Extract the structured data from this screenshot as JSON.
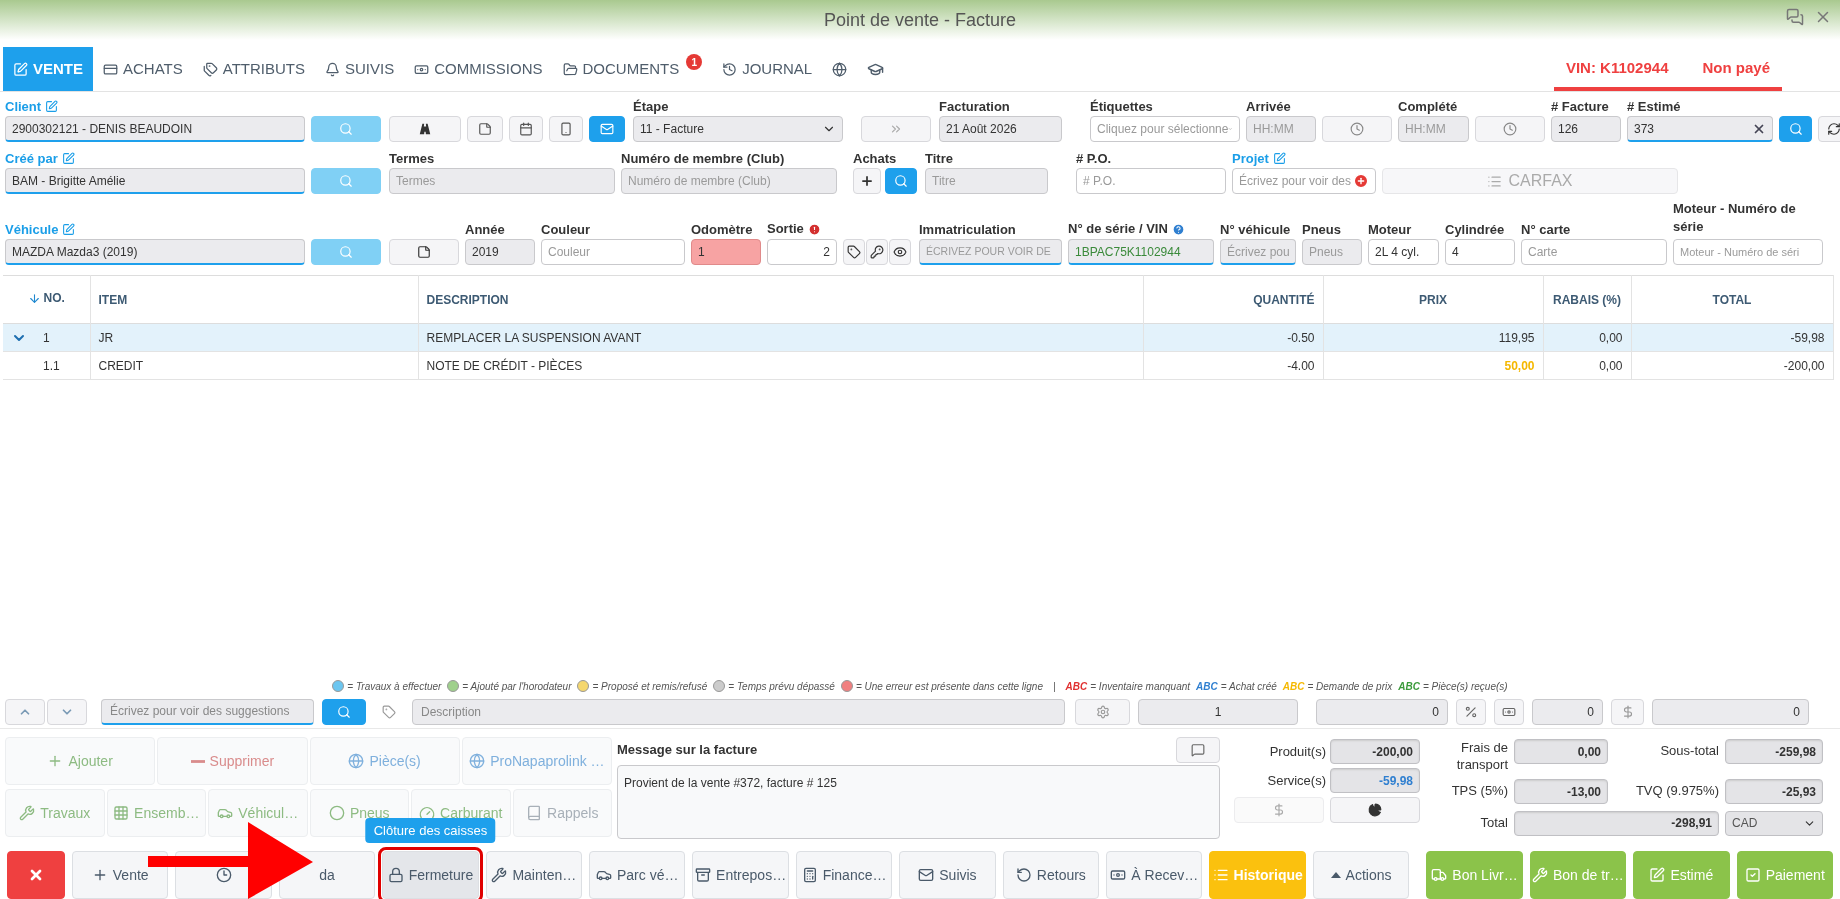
{
  "window": {
    "title": "Point de vente - Facture"
  },
  "tabs": [
    {
      "label": "VENTE",
      "selected": true
    },
    {
      "label": "ACHATS",
      "selected": false
    },
    {
      "label": "ATTRIBUTS",
      "selected": false
    },
    {
      "label": "SUIVIS",
      "selected": false
    },
    {
      "label": "COMMISSIONS",
      "selected": false
    },
    {
      "label": "DOCUMENTS",
      "selected": false,
      "badge": "1"
    },
    {
      "label": "JOURNAL",
      "selected": false
    }
  ],
  "status": {
    "vin": "VIN: K1102944",
    "payment": "Non payé"
  },
  "form": {
    "client": {
      "label": "Client",
      "editable": true,
      "value": "2900302121 - DENIS BEAUDOIN"
    },
    "email_button": {
      "selected": true
    },
    "stage": {
      "label": "Étape",
      "value": "11 - Facture"
    },
    "billing": {
      "label": "Facturation",
      "value": "21 Août 2026"
    },
    "tags": {
      "label": "Étiquettes",
      "placeholder": "Cliquez pour sélectionne"
    },
    "arrival": {
      "label": "Arrivée",
      "placeholder": "HH:MM"
    },
    "completed": {
      "label": "Complété",
      "placeholder": "HH:MM"
    },
    "invoice_no": {
      "label": "# Facture",
      "value": "126"
    },
    "estimate_no": {
      "label": "# Estimé",
      "value": "373"
    },
    "created_by": {
      "label": "Créé par",
      "editable": true,
      "value": "BAM - Brigitte Amélie"
    },
    "terms": {
      "label": "Termes",
      "placeholder": "Termes"
    },
    "member_no": {
      "label": "Numéro de membre (Club)",
      "placeholder": "Numéro de membre (Club)"
    },
    "purchases": {
      "label": "Achats"
    },
    "title": {
      "label": "Titre",
      "placeholder": "Titre"
    },
    "po": {
      "label": "# P.O.",
      "placeholder": "# P.O."
    },
    "project": {
      "label": "Projet",
      "editable": true,
      "placeholder": "Écrivez pour voir des"
    },
    "carfax": {
      "label": "CARFAX"
    },
    "vehicle": {
      "label": "Véhicule",
      "editable": true,
      "value": "MAZDA Mazda3 (2019)"
    },
    "year": {
      "label": "Année",
      "value": "2019"
    },
    "color": {
      "label": "Couleur",
      "placeholder": "Couleur"
    },
    "odometer": {
      "label": "Odomètre",
      "value": "1",
      "error": true
    },
    "exit": {
      "label": "Sortie",
      "value": "2"
    },
    "plate": {
      "label": "Immatriculation",
      "placeholder": "ÉCRIVEZ POUR VOIR DE"
    },
    "vin": {
      "label": "N° de série / VIN",
      "value": "1BPAC75K1102944"
    },
    "vehicle_no": {
      "label": "N° véhicule",
      "placeholder": "Écrivez pou"
    },
    "tires": {
      "label": "Pneus",
      "placeholder": "Pneus"
    },
    "engine": {
      "label": "Moteur",
      "value": "2L  4 cyl."
    },
    "cylinders": {
      "label": "Cylindrée",
      "value": "4"
    },
    "card_no": {
      "label": "N° carte",
      "placeholder": "Carte"
    },
    "engine_serial": {
      "label": "Moteur - Numéro de série",
      "placeholder": "Moteur - Numéro de séri"
    }
  },
  "table": {
    "columns": [
      "NO.",
      "ITEM",
      "DESCRIPTION",
      "QUANTITÉ",
      "PRIX",
      "RABAIS (%)",
      "TOTAL"
    ],
    "rows": [
      {
        "no": "1",
        "item": "JR",
        "description": "REMPLACER LA SUSPENSION AVANT",
        "quantity": "-0.50",
        "price": "119,95",
        "discount": "0,00",
        "total": "-59,98",
        "selected": true,
        "expanded": true,
        "price_highlight": false
      },
      {
        "no": "1.1",
        "item": "CREDIT",
        "description": "NOTE DE CRÉDIT - PIÈCES",
        "quantity": "-4.00",
        "price": "50,00",
        "discount": "0,00",
        "total": "-200,00",
        "selected": false,
        "expanded": false,
        "price_highlight": true
      }
    ]
  },
  "legend": {
    "dots": [
      {
        "color": "#6cc6f0",
        "text": "= Travaux à effectuer"
      },
      {
        "color": "#9fd08c",
        "text": "= Ajouté par l'horodateur"
      },
      {
        "color": "#f5d76e",
        "text": "= Proposé et remis/refusé"
      },
      {
        "color": "#cccccc",
        "text": "= Temps prévu dépassé"
      },
      {
        "color": "#f08080",
        "text": "= Une erreur est présente dans cette ligne"
      }
    ],
    "separator": "|",
    "codes": [
      {
        "abc": "ABC",
        "color": "#e03030",
        "text": "= Inventaire manquant"
      },
      {
        "abc": "ABC",
        "color": "#2f7fd0",
        "text": "= Achat créé"
      },
      {
        "abc": "ABC",
        "color": "#f5b800",
        "text": "= Demande de prix"
      },
      {
        "abc": "ABC",
        "color": "#3a9a3a",
        "text": "= Pièce(s) reçue(s)"
      }
    ]
  },
  "entry": {
    "search_placeholder": "Écrivez pour voir des suggestions",
    "description_placeholder": "Description",
    "quantity": "1",
    "discount": "0",
    "amount": "0",
    "total": "0"
  },
  "tools": [
    {
      "label": "Ajouter",
      "color": "#8dbb82"
    },
    {
      "label": "Supprimer",
      "color": "#d98c8c"
    },
    {
      "label": "Pièce(s)",
      "color": "#7fb0dd"
    },
    {
      "label": "ProNapaprolink …",
      "color": "#7fb0dd"
    },
    {
      "label": "Travaux",
      "color": "#8dbb82"
    },
    {
      "label": "Ensemb…",
      "color": "#8dbb82"
    },
    {
      "label": "Véhicul…",
      "color": "#8dbb82"
    },
    {
      "label": "Pneus",
      "color": "#8dbb82"
    },
    {
      "label": "Carburant",
      "color": "#8dbb82"
    },
    {
      "label": "Rappels",
      "color": "#a8b0b8"
    }
  ],
  "message": {
    "label": "Message sur la facture",
    "value": "Provient de la vente #372, facture # 125"
  },
  "totals": {
    "products": {
      "label": "Produit(s)",
      "value": "-200,00"
    },
    "services": {
      "label": "Service(s)",
      "value": "-59,98"
    },
    "shipping": {
      "label": "Frais de transport",
      "value": "0,00"
    },
    "subtotal": {
      "label": "Sous-total",
      "value": "-259,98"
    },
    "gst": {
      "label": "TPS (5%)",
      "value": "-13,00"
    },
    "qst": {
      "label": "TVQ (9.975%)",
      "value": "-25,93"
    },
    "total": {
      "label": "Total",
      "value": "-298,91"
    },
    "currency": {
      "value": "CAD"
    }
  },
  "actions": [
    {
      "kind": "danger",
      "highlighted": false
    },
    {
      "label": "Vente",
      "kind": "default",
      "highlighted": false
    },
    {
      "kind": "default",
      "highlighted": false
    },
    {
      "label": "da",
      "kind": "default",
      "highlighted": false
    },
    {
      "label": "Fermeture",
      "kind": "default",
      "highlighted": true,
      "tooltip": "Clôture des caisses"
    },
    {
      "label": "Mainten…",
      "kind": "default",
      "highlighted": false
    },
    {
      "label": "Parc vé…",
      "kind": "default",
      "highlighted": false
    },
    {
      "label": "Entrepos…",
      "kind": "default",
      "highlighted": false
    },
    {
      "label": "Finance…",
      "kind": "default",
      "highlighted": false
    },
    {
      "label": "Suivis",
      "kind": "default",
      "highlighted": false
    },
    {
      "label": "Retours",
      "kind": "default",
      "highlighted": false
    },
    {
      "label": "À Recev…",
      "kind": "default",
      "highlighted": false
    },
    {
      "label": "Historique",
      "kind": "warning",
      "highlighted": false
    },
    {
      "label": "Actions",
      "kind": "default",
      "highlighted": false
    },
    {
      "label": "Bon Livr…",
      "kind": "success",
      "highlighted": false
    },
    {
      "label": "Bon de tr…",
      "kind": "success",
      "highlighted": false
    },
    {
      "label": "Estimé",
      "kind": "success",
      "highlighted": false
    },
    {
      "label": "Paiement",
      "kind": "success",
      "highlighted": false
    }
  ]
}
